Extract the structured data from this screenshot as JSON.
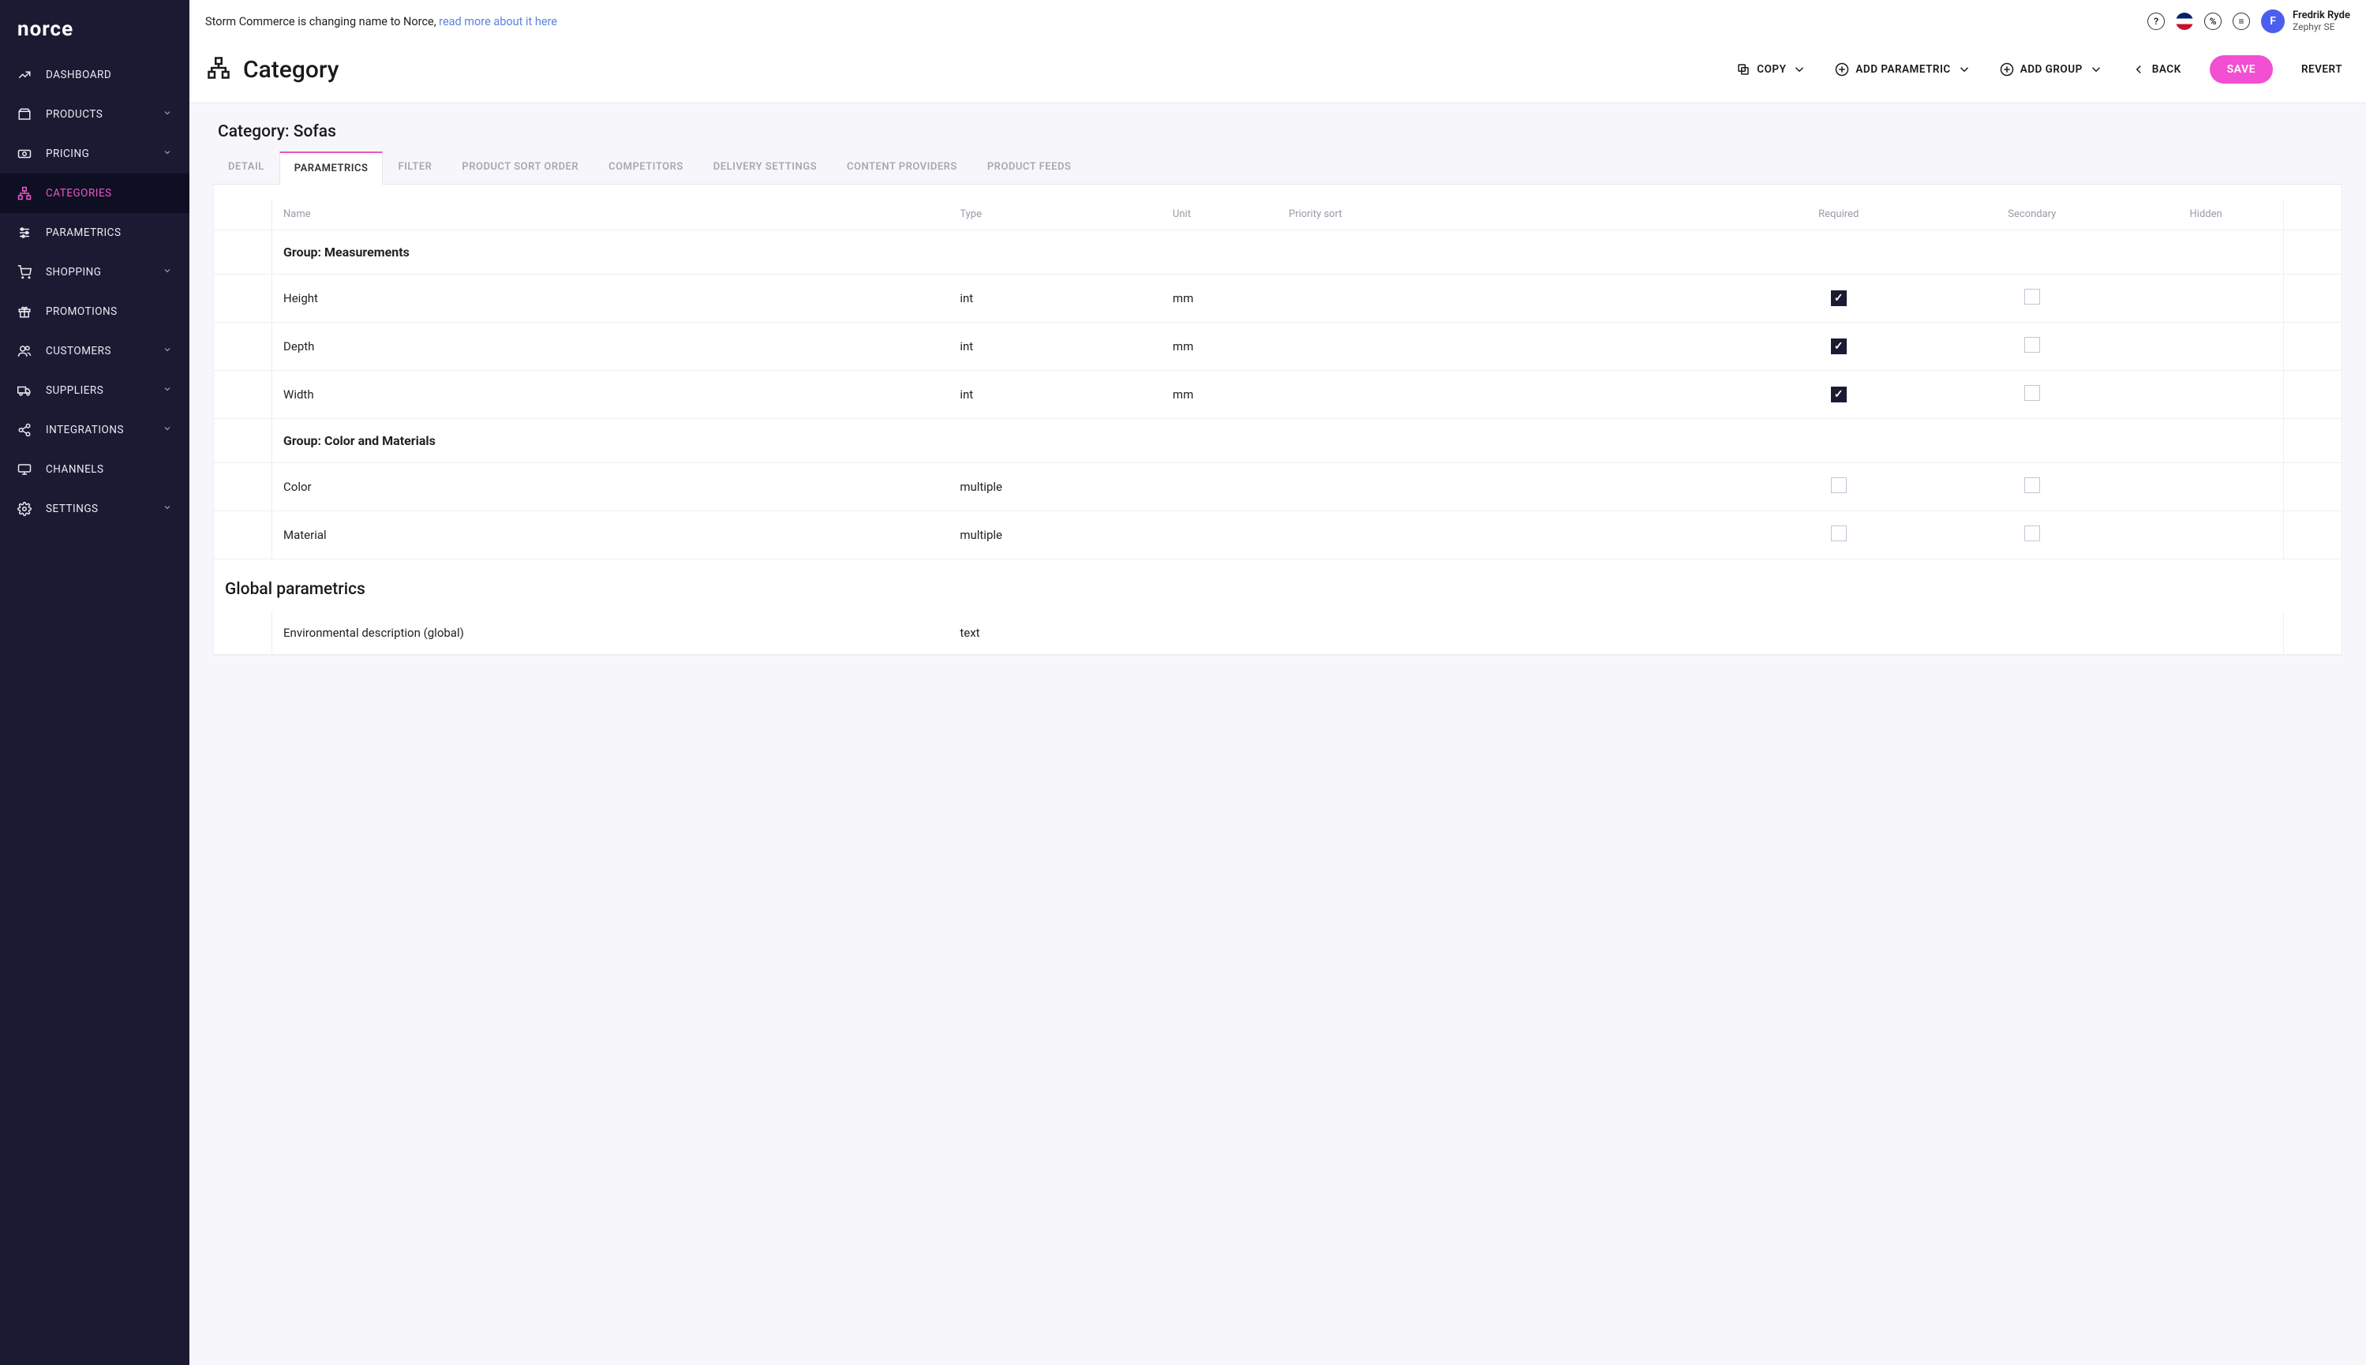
{
  "brand": "norce",
  "announcement": {
    "prefix": "Storm Commerce is changing name to Norce, ",
    "link_text": "read more about it here"
  },
  "user": {
    "initial": "F",
    "name": "Fredrik Ryde",
    "org": "Zephyr SE"
  },
  "sidebar": {
    "items": [
      {
        "label": "DASHBOARD",
        "name": "dashboard",
        "expandable": false
      },
      {
        "label": "PRODUCTS",
        "name": "products",
        "expandable": true
      },
      {
        "label": "PRICING",
        "name": "pricing",
        "expandable": true
      },
      {
        "label": "CATEGORIES",
        "name": "categories",
        "expandable": false,
        "active": true
      },
      {
        "label": "PARAMETRICS",
        "name": "parametrics",
        "expandable": false
      },
      {
        "label": "SHOPPING",
        "name": "shopping",
        "expandable": true
      },
      {
        "label": "PROMOTIONS",
        "name": "promotions",
        "expandable": false
      },
      {
        "label": "CUSTOMERS",
        "name": "customers",
        "expandable": true
      },
      {
        "label": "SUPPLIERS",
        "name": "suppliers",
        "expandable": true
      },
      {
        "label": "INTEGRATIONS",
        "name": "integrations",
        "expandable": true
      },
      {
        "label": "CHANNELS",
        "name": "channels",
        "expandable": false
      },
      {
        "label": "SETTINGS",
        "name": "settings",
        "expandable": true
      }
    ]
  },
  "page": {
    "title": "Category",
    "actions": {
      "copy": "COPY",
      "add_parametric": "ADD PARAMETRIC",
      "add_group": "ADD GROUP",
      "back": "BACK",
      "save": "SAVE",
      "revert": "REVERT"
    },
    "breadcrumb": "Category: Sofas",
    "tabs": [
      {
        "label": "DETAIL",
        "name": "detail"
      },
      {
        "label": "PARAMETRICS",
        "name": "parametrics",
        "active": true
      },
      {
        "label": "FILTER",
        "name": "filter"
      },
      {
        "label": "PRODUCT SORT ORDER",
        "name": "product-sort-order"
      },
      {
        "label": "COMPETITORS",
        "name": "competitors"
      },
      {
        "label": "DELIVERY SETTINGS",
        "name": "delivery-settings"
      },
      {
        "label": "CONTENT PROVIDERS",
        "name": "content-providers"
      },
      {
        "label": "PRODUCT FEEDS",
        "name": "product-feeds"
      }
    ],
    "columns": {
      "name": "Name",
      "type": "Type",
      "unit": "Unit",
      "priority": "Priority sort",
      "required": "Required",
      "secondary": "Secondary",
      "hidden": "Hidden"
    },
    "groups": [
      {
        "title": "Group: Measurements",
        "rows": [
          {
            "name": "Height",
            "type": "int",
            "unit": "mm",
            "required": true,
            "secondary": false
          },
          {
            "name": "Depth",
            "type": "int",
            "unit": "mm",
            "required": true,
            "secondary": false
          },
          {
            "name": "Width",
            "type": "int",
            "unit": "mm",
            "required": true,
            "secondary": false
          }
        ]
      },
      {
        "title": "Group: Color and Materials",
        "rows": [
          {
            "name": "Color",
            "type": "multiple",
            "unit": "",
            "required": false,
            "secondary": false
          },
          {
            "name": "Material",
            "type": "multiple",
            "unit": "",
            "required": false,
            "secondary": false
          }
        ]
      }
    ],
    "global_section_title": "Global parametrics",
    "global_rows": [
      {
        "name": "Environmental description (global)",
        "type": "text",
        "unit": ""
      }
    ]
  }
}
